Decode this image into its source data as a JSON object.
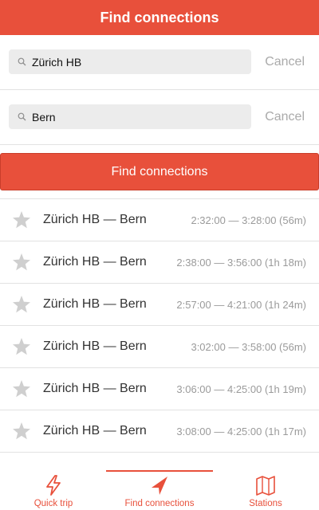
{
  "header": {
    "title": "Find connections"
  },
  "from": {
    "value": "Zürich HB",
    "cancel_label": "Cancel"
  },
  "to": {
    "value": "Bern",
    "cancel_label": "Cancel"
  },
  "find_button": {
    "label": "Find connections"
  },
  "connections": [
    {
      "route": "Zürich HB — Bern",
      "time": "2:32:00 — 3:28:00 (56m)"
    },
    {
      "route": "Zürich HB — Bern",
      "time": "2:38:00 — 3:56:00 (1h 18m)"
    },
    {
      "route": "Zürich HB — Bern",
      "time": "2:57:00 — 4:21:00 (1h 24m)"
    },
    {
      "route": "Zürich HB — Bern",
      "time": "3:02:00 — 3:58:00 (56m)"
    },
    {
      "route": "Zürich HB — Bern",
      "time": "3:06:00 — 4:25:00 (1h 19m)"
    },
    {
      "route": "Zürich HB — Bern",
      "time": "3:08:00 — 4:25:00 (1h 17m)"
    }
  ],
  "tabs": {
    "quick_trip": {
      "label": "Quick trip",
      "icon": "lightning-icon"
    },
    "find_connections": {
      "label": "Find connections",
      "icon": "navigation-arrow-icon"
    },
    "stations": {
      "label": "Stations",
      "icon": "map-icon"
    }
  },
  "colors": {
    "accent": "#e8503b",
    "muted": "#9a9a9a",
    "star": "#cfcfcf"
  }
}
